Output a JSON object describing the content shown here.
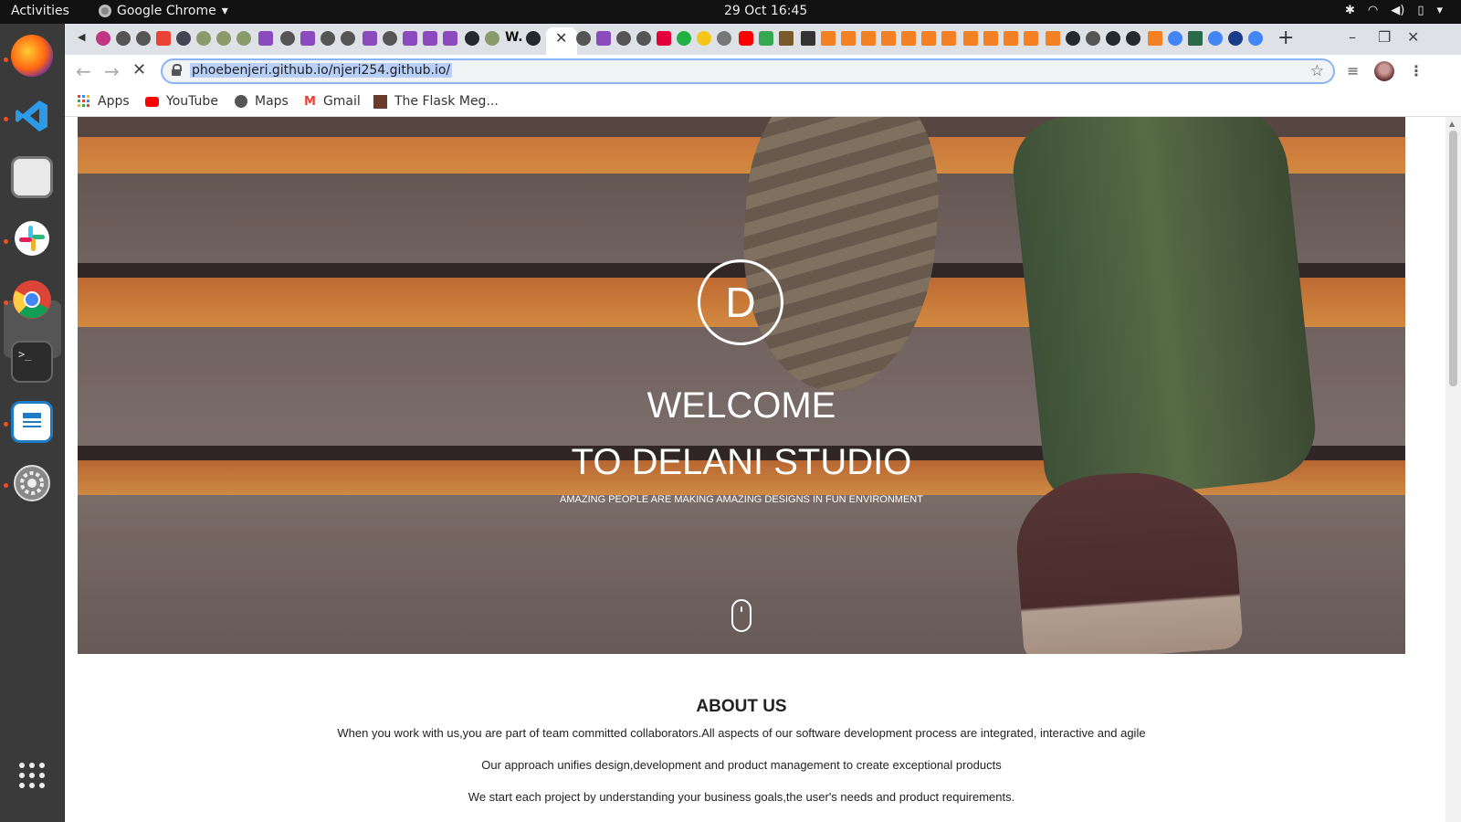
{
  "topbar": {
    "activities": "Activities",
    "app_name": "Google Chrome",
    "clock": "29 Oct  16:45"
  },
  "browser": {
    "url": "phoebenjeri.github.io/njeri254.github.io/",
    "bookmarks": [
      "Apps",
      "YouTube",
      "Maps",
      "Gmail",
      "The Flask Meg..."
    ]
  },
  "hero": {
    "logo_letter": "D",
    "title_line1": "WELCOME",
    "title_line2": "TO DELANI STUDIO",
    "subtitle": "AMAZING PEOPLE ARE MAKING AMAZING DESIGNS IN FUN ENVIRONMENT"
  },
  "about": {
    "heading": "ABOUT US",
    "paragraphs": [
      "When you work with us,you are part of team committed collaborators.All aspects of our software development process are integrated, interactive and agile",
      "Our approach unifies design,development and product management to create exceptional products",
      "We start each project by understanding your business goals,the user's needs and product requirements."
    ]
  },
  "colors": {
    "accent": "#8ab4f8",
    "dock_bg": "#3a3a3a",
    "topbar_bg": "#111111",
    "tabstrip_bg": "#dee1e6",
    "running_dot": "#e95420"
  },
  "icons": {
    "dock": [
      "firefox-icon",
      "vscode-icon",
      "files-icon",
      "slack-icon",
      "chrome-icon",
      "terminal-icon",
      "writer-icon",
      "settings-icon",
      "app-grid-icon"
    ]
  }
}
